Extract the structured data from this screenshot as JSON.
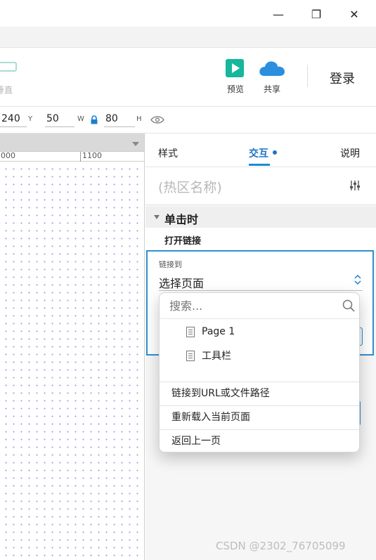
{
  "window": {
    "minimize": "—",
    "maximize": "❐",
    "close": "✕"
  },
  "toolbar": {
    "vertical_label": "垂直",
    "preview_label": "预览",
    "share_label": "共享",
    "login_label": "登录",
    "colors": {
      "preview": "#16b79b",
      "share": "#2b8fe0"
    }
  },
  "props": {
    "x_value": "240",
    "y_label": "Y",
    "y_value": "50",
    "w_label": "W",
    "w_value": "80",
    "h_label": "H"
  },
  "canvas": {
    "ruler_1000": "000",
    "ruler_1100": "1100"
  },
  "panel": {
    "tabs": [
      {
        "label": "样式"
      },
      {
        "label": "交互"
      },
      {
        "label": "说明"
      }
    ],
    "hotspot_name_placeholder": "(热区名称)",
    "event_label": "单击时",
    "action_label": "打开链接",
    "link_to_label": "链接到",
    "select_value": "选择页面"
  },
  "dropdown": {
    "search_placeholder": "搜索...",
    "pages": [
      {
        "label": "Page 1"
      },
      {
        "label": "工具栏"
      }
    ],
    "actions": [
      {
        "label": "链接到URL或文件路径"
      },
      {
        "label": "重新载入当前页面"
      },
      {
        "label": "返回上一页"
      }
    ]
  },
  "watermark": "CSDN @2302_76705099"
}
